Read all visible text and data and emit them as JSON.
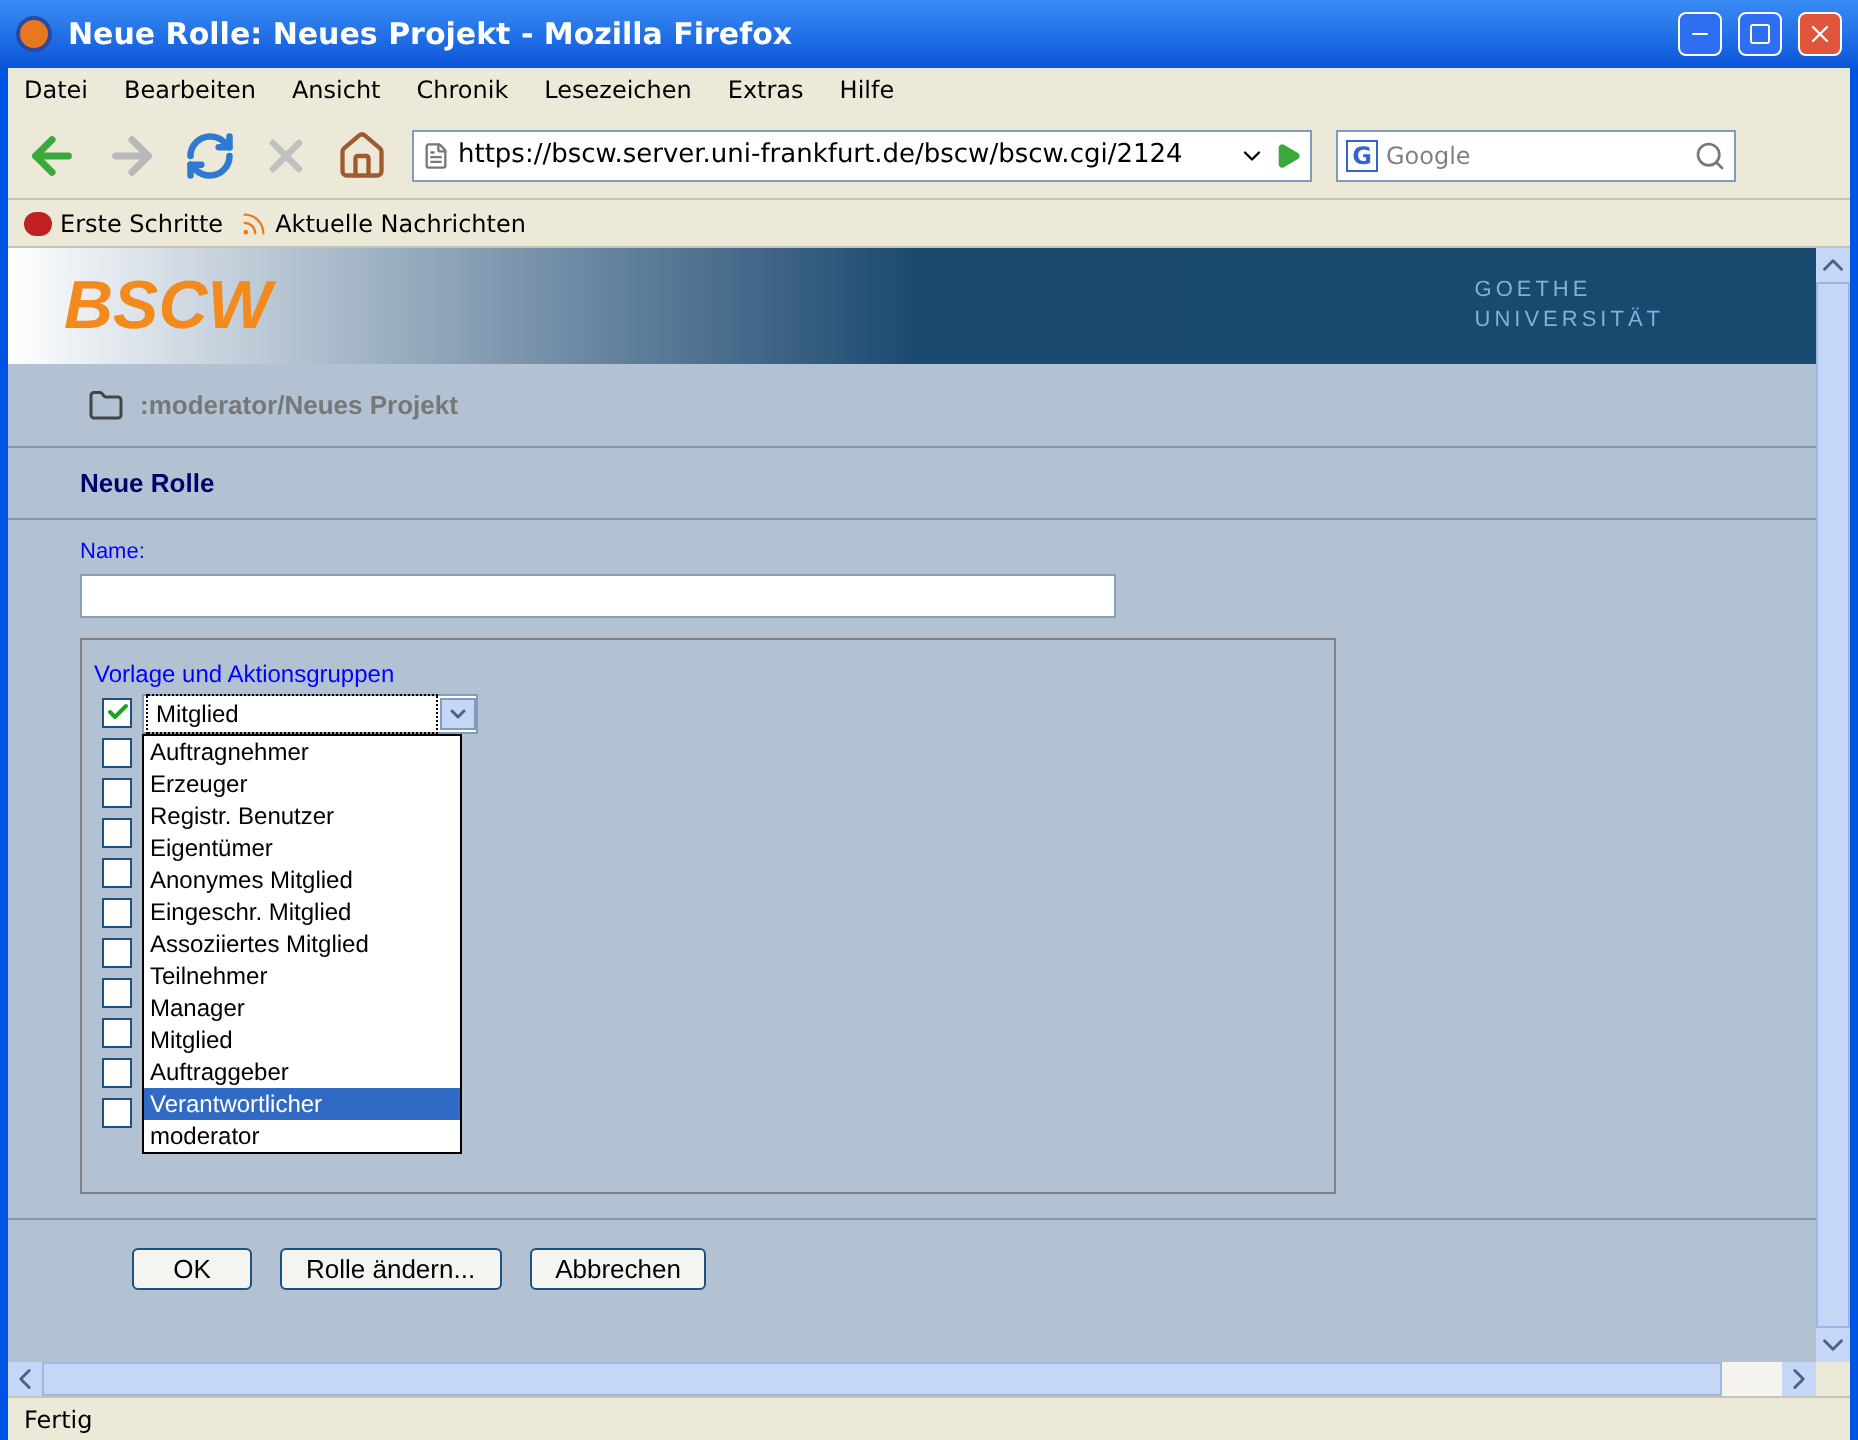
{
  "window": {
    "title": "Neue Rolle: Neues Projekt - Mozilla Firefox"
  },
  "menu": [
    "Datei",
    "Bearbeiten",
    "Ansicht",
    "Chronik",
    "Lesezeichen",
    "Extras",
    "Hilfe"
  ],
  "url": "https://bscw.server.uni-frankfurt.de/bscw/bscw.cgi/2124",
  "search": {
    "engine": "G",
    "placeholder": "Google"
  },
  "bookmarks": [
    "Erste Schritte",
    "Aktuelle Nachrichten"
  ],
  "page": {
    "logo": "BSCW",
    "university": [
      "GOETHE",
      "UNIVERSITÄT"
    ],
    "breadcrumb": ":moderator/Neues Projekt",
    "heading": "Neue Rolle",
    "name_label": "Name:",
    "group_label": "Vorlage und Aktionsgruppen",
    "checkboxes": [
      {
        "checked": true
      },
      {
        "checked": false
      },
      {
        "checked": false
      },
      {
        "checked": false
      },
      {
        "checked": false
      },
      {
        "checked": false
      },
      {
        "checked": false
      },
      {
        "checked": false
      },
      {
        "checked": false
      },
      {
        "checked": false
      },
      {
        "checked": false
      }
    ],
    "select": {
      "value": "Mitglied",
      "expanded": true,
      "options": [
        {
          "label": "Auftragnehmer",
          "highlighted": false
        },
        {
          "label": "Erzeuger",
          "highlighted": false
        },
        {
          "label": "Registr. Benutzer",
          "highlighted": false
        },
        {
          "label": "Eigentümer",
          "highlighted": false
        },
        {
          "label": "Anonymes Mitglied",
          "highlighted": false
        },
        {
          "label": "Eingeschr. Mitglied",
          "highlighted": false
        },
        {
          "label": "Assoziiertes Mitglied",
          "highlighted": false
        },
        {
          "label": "Teilnehmer",
          "highlighted": false
        },
        {
          "label": "Manager",
          "highlighted": false
        },
        {
          "label": "Mitglied",
          "highlighted": false
        },
        {
          "label": "Auftraggeber",
          "highlighted": false
        },
        {
          "label": "Verantwortlicher",
          "highlighted": true
        },
        {
          "label": "moderator",
          "highlighted": false
        }
      ]
    },
    "buttons": [
      "OK",
      "Rolle ändern...",
      "Abbrechen"
    ]
  },
  "status_bar": "Fertig"
}
